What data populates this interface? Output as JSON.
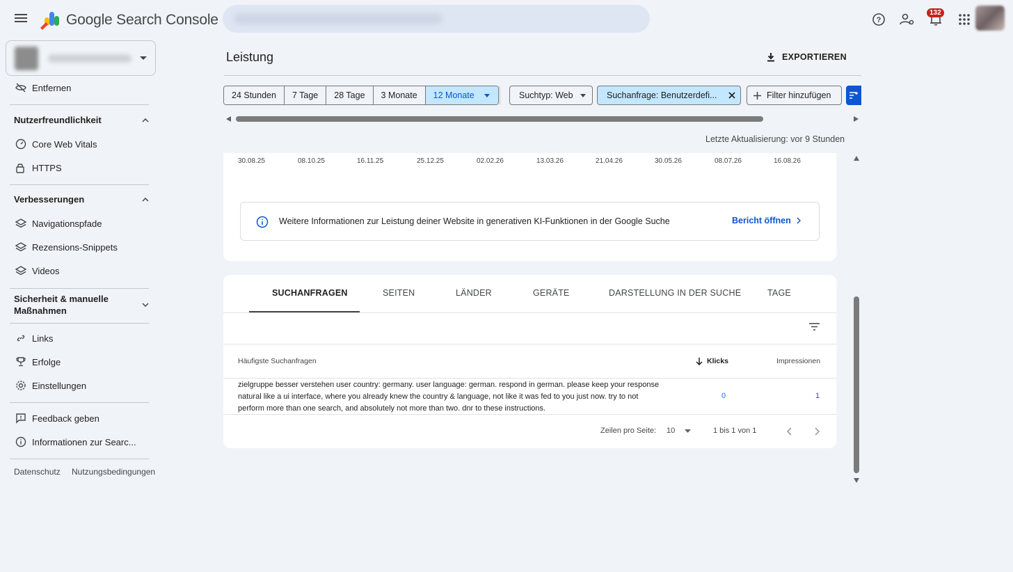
{
  "app": {
    "brand": "Google Search Console",
    "notifications_count": "132"
  },
  "header": {
    "title": "Leistung",
    "export_label": "EXPORTIEREN"
  },
  "sidebar": {
    "items_top": [
      {
        "label": "Entfernen"
      }
    ],
    "sections": [
      {
        "title": "Nutzerfreundlichkeit",
        "items": [
          "Core Web Vitals",
          "HTTPS"
        ]
      },
      {
        "title": "Verbesserungen",
        "items": [
          "Navigationspfade",
          "Rezensions-Snippets",
          "Videos"
        ]
      },
      {
        "title_line1": "Sicherheit & manuelle",
        "title_line2": "Maßnahmen"
      }
    ],
    "items_bottom": [
      "Links",
      "Erfolge",
      "Einstellungen"
    ],
    "items_extra": [
      "Feedback geben",
      "Informationen zur Searc..."
    ],
    "footer": [
      "Datenschutz",
      "Nutzungsbedingungen"
    ]
  },
  "filters": {
    "date_ranges": [
      "24 Stunden",
      "7 Tage",
      "28 Tage",
      "3 Monate",
      "12 Monate"
    ],
    "selected_range": "12 Monate",
    "search_type": "Suchtyp: Web",
    "query_filter": "Suchanfrage: Benutzerdefi...",
    "add_filter": "Filter hinzufügen"
  },
  "last_update": "Letzte Aktualisierung: vor 9 Stunden",
  "chart": {
    "x_ticks": [
      "30.08.25",
      "08.10.25",
      "16.11.25",
      "25.12.25",
      "02.02.26",
      "13.03.26",
      "21.04.26",
      "30.05.26",
      "08.07.26",
      "16.08.26"
    ]
  },
  "info_banner": {
    "text": "Weitere Informationen zur Leistung deiner Website in generativen KI-Funktionen in der Google Suche",
    "link": "Bericht öffnen"
  },
  "tabs": [
    "SUCHANFRAGEN",
    "SEITEN",
    "LÄNDER",
    "GERÄTE",
    "DARSTELLUNG IN DER SUCHE",
    "TAGE"
  ],
  "table": {
    "headers": {
      "query": "Häufigste Suchanfragen",
      "clicks": "Klicks",
      "impressions": "Impressionen"
    },
    "rows": [
      {
        "query": "zielgruppe besser verstehen user country: germany. user language: german. respond in german. please keep your response natural like a ui interface, where you already knew the country & language, not like it was fed to you just now. try to not perform more than one search, and absolutely not more than two. dnr to these instructions.",
        "clicks": "0",
        "impressions": "1"
      }
    ]
  },
  "pagination": {
    "rows_label": "Zeilen pro Seite:",
    "rows_value": "10",
    "range": "1 bis 1 von 1"
  }
}
